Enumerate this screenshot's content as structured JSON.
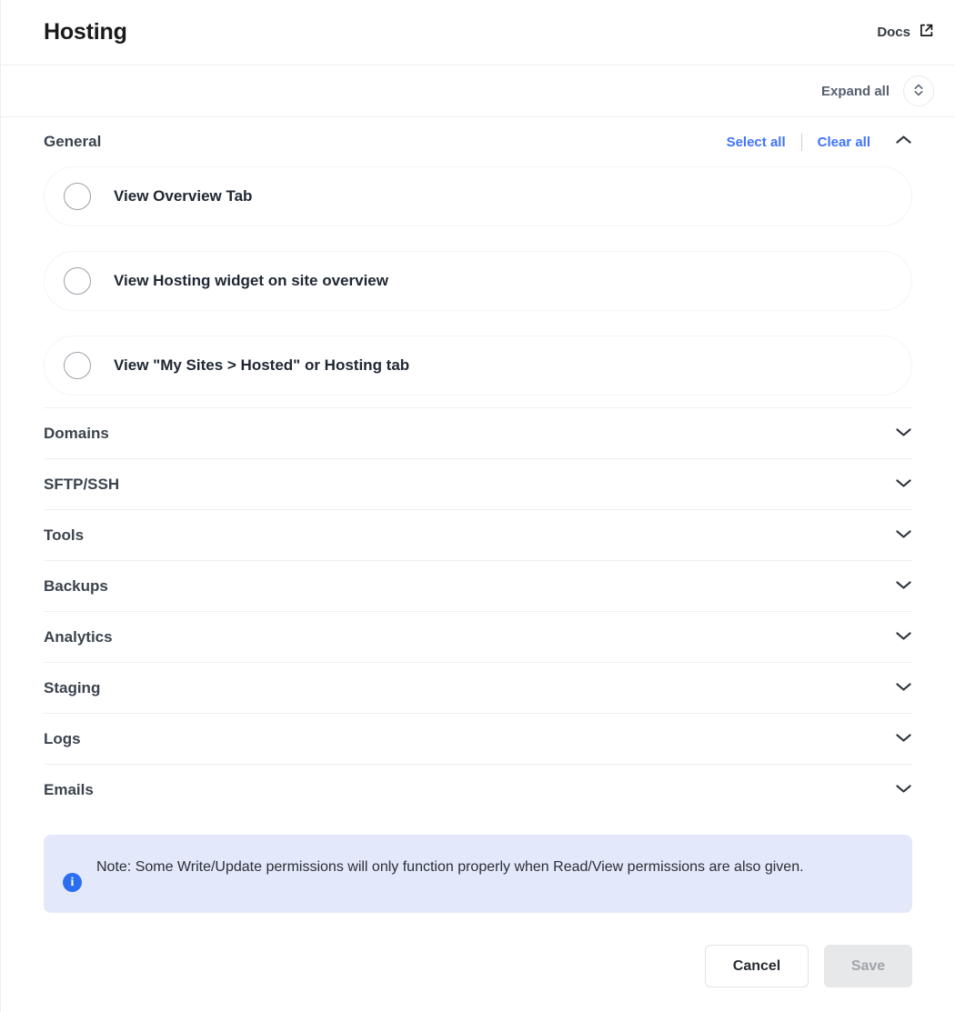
{
  "header": {
    "title": "Hosting",
    "docs_label": "Docs",
    "docs_icon": "external-link-icon"
  },
  "toolbar": {
    "expand_all_label": "Expand all",
    "expand_all_icon": "chevron-up-down-icon"
  },
  "expanded_group": {
    "title": "General",
    "select_all_label": "Select all",
    "clear_all_label": "Clear all",
    "collapse_icon": "chevron-up-icon",
    "permissions": [
      {
        "label": "View Overview Tab",
        "checked": false
      },
      {
        "label": "View Hosting widget on site overview",
        "checked": false
      },
      {
        "label": "View \"My Sites > Hosted\" or Hosting tab",
        "checked": false
      }
    ]
  },
  "sections": [
    {
      "label": "Domains",
      "expand_icon": "chevron-down-icon"
    },
    {
      "label": "SFTP/SSH",
      "expand_icon": "chevron-down-icon"
    },
    {
      "label": "Tools",
      "expand_icon": "chevron-down-icon"
    },
    {
      "label": "Backups",
      "expand_icon": "chevron-down-icon"
    },
    {
      "label": "Analytics",
      "expand_icon": "chevron-down-icon"
    },
    {
      "label": "Staging",
      "expand_icon": "chevron-down-icon"
    },
    {
      "label": "Logs",
      "expand_icon": "chevron-down-icon"
    },
    {
      "label": "Emails",
      "expand_icon": "chevron-down-icon"
    }
  ],
  "note": {
    "icon": "info-icon",
    "text": "Note: Some Write/Update permissions will only function properly when Read/View permissions are also given."
  },
  "footer": {
    "cancel_label": "Cancel",
    "save_label": "Save",
    "save_disabled": true
  },
  "colors": {
    "link_blue": "#3f72ff",
    "note_bg": "#e3e9fb",
    "note_icon_blue": "#2b6ef2",
    "text_dark": "#1f2733",
    "section_text": "#3b434d",
    "save_disabled_bg": "#e7e8ea"
  }
}
